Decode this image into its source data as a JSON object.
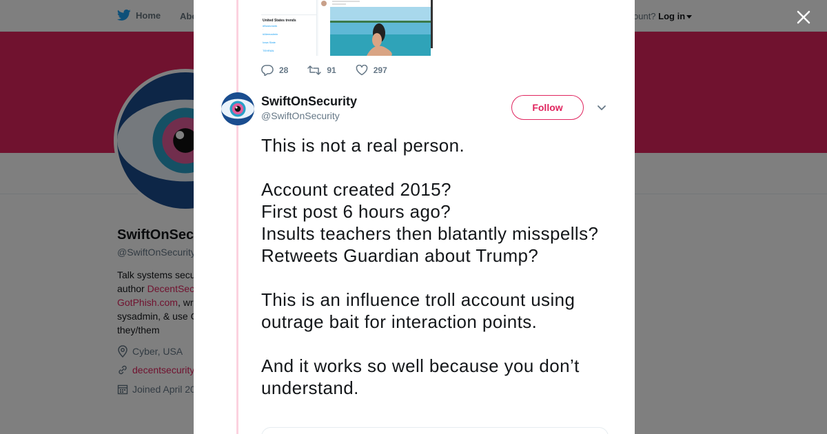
{
  "nav": {
    "home_label": "Home",
    "about_label": "Abo",
    "account_text": "ccount?",
    "login_label": "Log in"
  },
  "profile": {
    "name": "SwiftOnSec",
    "handle": "@SwiftOnSecurity",
    "bio_line1": "Talk systems secu",
    "bio_line2_prefix": "author ",
    "bio_line2_link": "DecentSec",
    "bio_line3_link": "GotPhish.com",
    "bio_line3_suffix": ", wr",
    "bio_line4": "sysadmin, & use C",
    "bio_line5": "they/them",
    "location": "Cyber, USA",
    "website": "decentsecurity",
    "joined": "Joined April 20"
  },
  "previous_tweet": {
    "trends_title": "United States trends",
    "trend_items": [
      "#Bostonstrk",
      "#Alemadmin",
      "Iowa State",
      "TEHRAN"
    ],
    "replies": "28",
    "retweets": "91",
    "likes": "297"
  },
  "tweet": {
    "author_name": "SwiftOnSecurity",
    "author_handle": "@SwiftOnSecurity",
    "follow_label": "Follow",
    "lines": [
      "This is not a real person.",
      "",
      "Account created 2015?",
      "First post 6 hours ago?",
      "Insults teachers then blatantly misspells?",
      "Retweets Guardian about Trump?",
      "",
      "This is an influence troll account using outrage bait for interaction points.",
      "",
      "And it works so well because you don’t understand."
    ]
  },
  "colors": {
    "accent": "#e0245e",
    "twitter_blue": "#1da1f2",
    "muted": "#657786"
  }
}
